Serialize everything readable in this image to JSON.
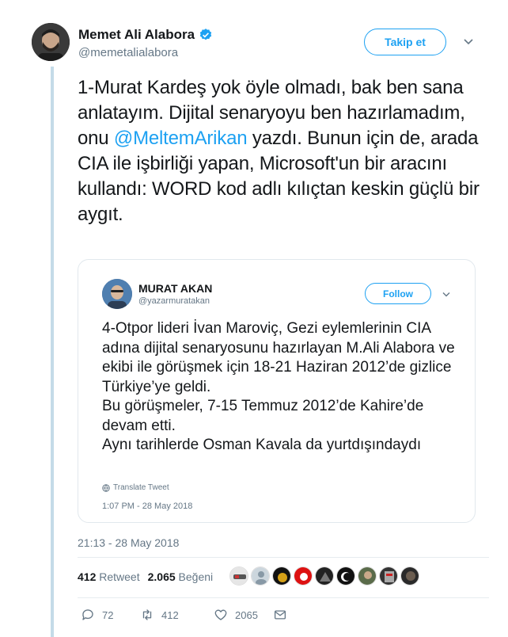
{
  "author": {
    "name": "Memet Ali Alabora",
    "handle": "@memetalialabora",
    "follow_label": "Takip et"
  },
  "tweet": {
    "text_before": "1-Murat Kardeş yok öyle olmadı, bak ben sana anlatayım. Dijital senaryoyu ben hazırlamadım, onu ",
    "mention": "@MeltemArikan",
    "text_after": " yazdı. Bunun için de, arada CIA ile işbirliği yapan, Microsoft'un bir aracını kullandı: WORD kod adlı kılıçtan keskin güçlü bir aygıt."
  },
  "quoted": {
    "name": "MURAT AKAN",
    "handle": "@yazarmuratakan",
    "follow_label": "Follow",
    "text": "4-Otpor lideri İvan Maroviç, Gezi eylemlerinin CIA adına dijital senaryosunu hazırlayan M.Ali Alabora ve ekibi ile görüşmek için 18-21 Haziran 2012’de gizlice Türkiye’ye geldi.\nBu görüşmeler, 7-15 Temmuz 2012’de Kahire’de devam etti.\nAynı tarihlerde Osman Kavala da yurtdışındaydı",
    "translate_label": "Translate Tweet",
    "time": "1:07 PM - 28 May 2018"
  },
  "meta": {
    "timestamp": "21:13 - 28 May 2018",
    "retweet_count": "412",
    "retweet_label": "Retweet",
    "like_count": "2.065",
    "like_label": "Beğeni"
  },
  "actions": {
    "reply_count": "72",
    "retweet_count": "412",
    "like_count": "2065"
  },
  "colors": {
    "accent": "#1da1f2",
    "thread_line": "#c4dbe8",
    "muted": "#657786"
  }
}
